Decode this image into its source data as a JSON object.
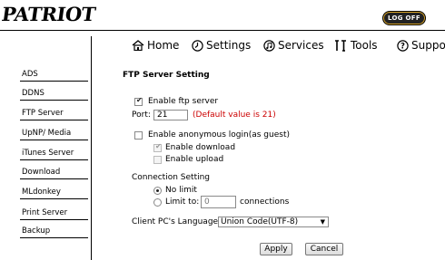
{
  "header": {
    "logo_text": "PATRIOT",
    "logout_label": "LOG OFF"
  },
  "nav": [
    {
      "label": "Home",
      "icon": "home-icon"
    },
    {
      "label": "Settings",
      "icon": "clock-icon"
    },
    {
      "label": "Services",
      "icon": "music-icon"
    },
    {
      "label": "Tools",
      "icon": "tools-icon"
    },
    {
      "label": "Support",
      "icon": "help-icon"
    }
  ],
  "sidebar": [
    {
      "label": "ADS"
    },
    {
      "label": "DDNS"
    },
    {
      "label": "FTP Server"
    },
    {
      "label": "UpNP/ Media"
    },
    {
      "label": "iTunes Server"
    },
    {
      "label": "Download"
    },
    {
      "label": "MLdonkey"
    },
    {
      "label": "Print Server"
    },
    {
      "label": "Backup"
    }
  ],
  "ftp": {
    "title": "FTP Server Setting",
    "enable_ftp_label": "Enable ftp server",
    "enable_ftp_checked": true,
    "port_label": "Port:",
    "port_value": "21",
    "port_hint": "(Default value is 21)",
    "anonymous_label": "Enable anonymous login(as guest)",
    "anonymous_checked": false,
    "enable_download_label": "Enable download",
    "enable_download_checked": true,
    "enable_upload_label": "Enable upload",
    "enable_upload_checked": false,
    "connection_heading": "Connection Setting",
    "no_limit_label": "No limit",
    "limit_to_label": "Limit to:",
    "limit_value": "0",
    "connections_label": "connections",
    "language_label": "Client PC's Language:",
    "language_value": "Union Code(UTF-8)",
    "apply_label": "Apply",
    "cancel_label": "Cancel"
  },
  "colors": {
    "hint": "#cc0000",
    "logout_border": "#d9a528"
  }
}
